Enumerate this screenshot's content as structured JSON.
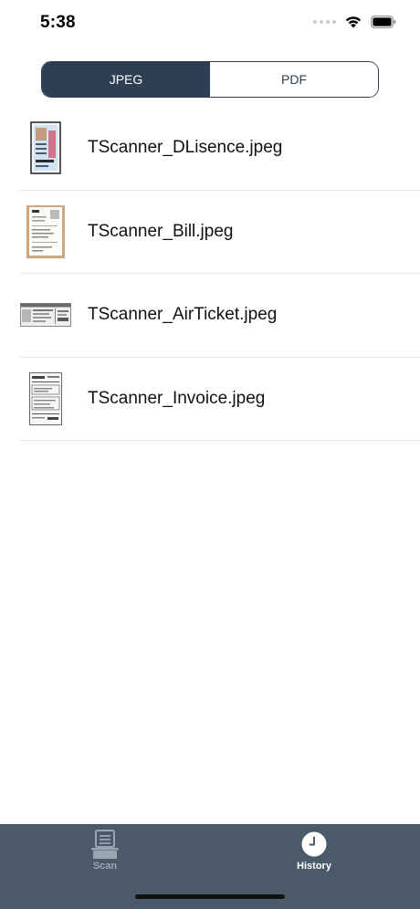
{
  "status_bar": {
    "time": "5:38"
  },
  "segment": {
    "options": [
      {
        "label": "JPEG",
        "selected": true
      },
      {
        "label": "PDF",
        "selected": false
      }
    ]
  },
  "files": [
    {
      "name": "TScanner_DLisence.jpeg",
      "thumb_icon": "license-thumbnail"
    },
    {
      "name": "TScanner_Bill.jpeg",
      "thumb_icon": "bill-thumbnail"
    },
    {
      "name": "TScanner_AirTicket.jpeg",
      "thumb_icon": "air-ticket-thumbnail"
    },
    {
      "name": "TScanner_Invoice.jpeg",
      "thumb_icon": "invoice-thumbnail"
    }
  ],
  "tab_bar": {
    "tabs": [
      {
        "label": "Scan",
        "icon": "scanner-icon",
        "active": false
      },
      {
        "label": "History",
        "icon": "clock-icon",
        "active": true
      }
    ]
  },
  "colors": {
    "accent": "#2f3f53",
    "tab_bar_bg": "#4b5a6b",
    "tab_inactive": "#9aa5b2",
    "tab_active": "#ffffff"
  }
}
